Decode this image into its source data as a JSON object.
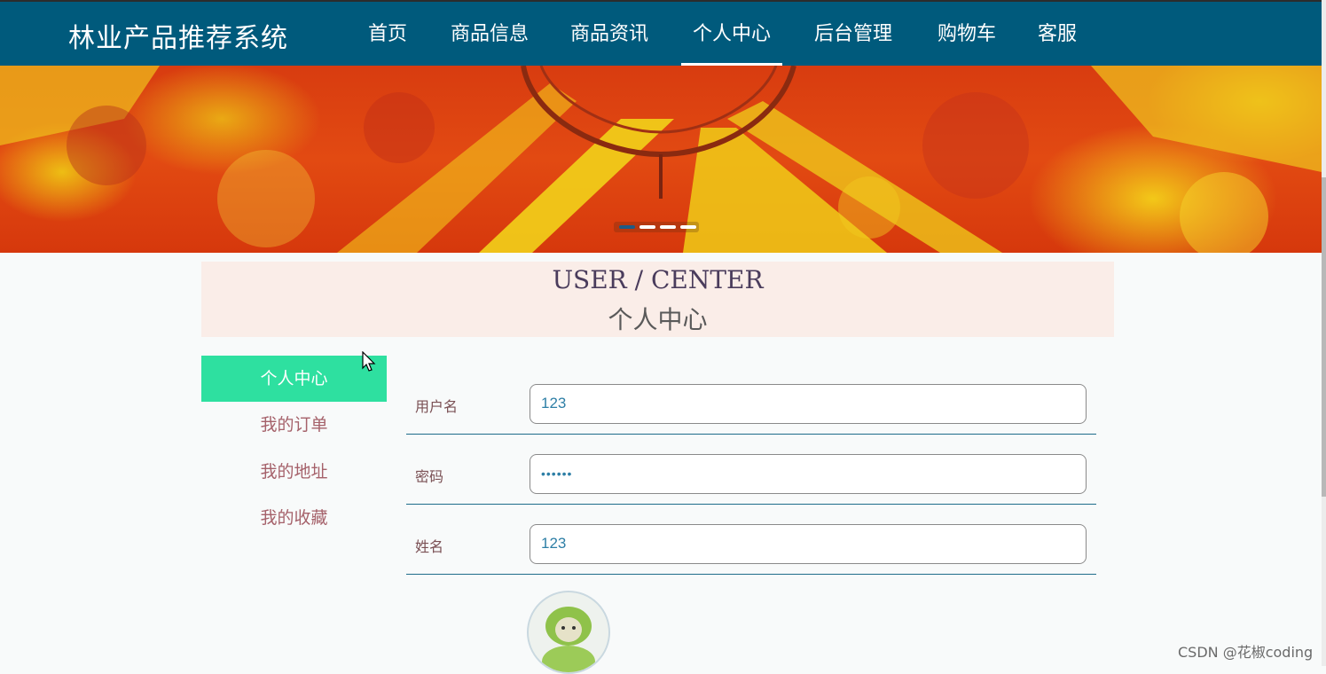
{
  "brand": "林业产品推荐系统",
  "nav": {
    "items": [
      {
        "label": "首页"
      },
      {
        "label": "商品信息"
      },
      {
        "label": "商品资讯"
      },
      {
        "label": "个人中心"
      },
      {
        "label": "后台管理"
      },
      {
        "label": "购物车"
      },
      {
        "label": "客服"
      }
    ],
    "active_index": 3
  },
  "banner": {
    "slide_count": 4,
    "active_slide": 1
  },
  "header": {
    "title_en": "USER / CENTER",
    "title_cn": "个人中心"
  },
  "sidebar": {
    "items": [
      {
        "label": "个人中心"
      },
      {
        "label": "我的订单"
      },
      {
        "label": "我的地址"
      },
      {
        "label": "我的收藏"
      }
    ],
    "active_index": 0
  },
  "form": {
    "username": {
      "label": "用户名",
      "value": "123"
    },
    "password": {
      "label": "密码",
      "value": "••••••"
    },
    "name": {
      "label": "姓名",
      "value": "123"
    }
  },
  "watermark": "CSDN @花椒coding",
  "colors": {
    "navbar": "#005a7c",
    "active_menu": "#2ee0a0",
    "title_box": "#faede8",
    "menu_text": "#a5616a",
    "input_text": "#2e7fa6"
  }
}
